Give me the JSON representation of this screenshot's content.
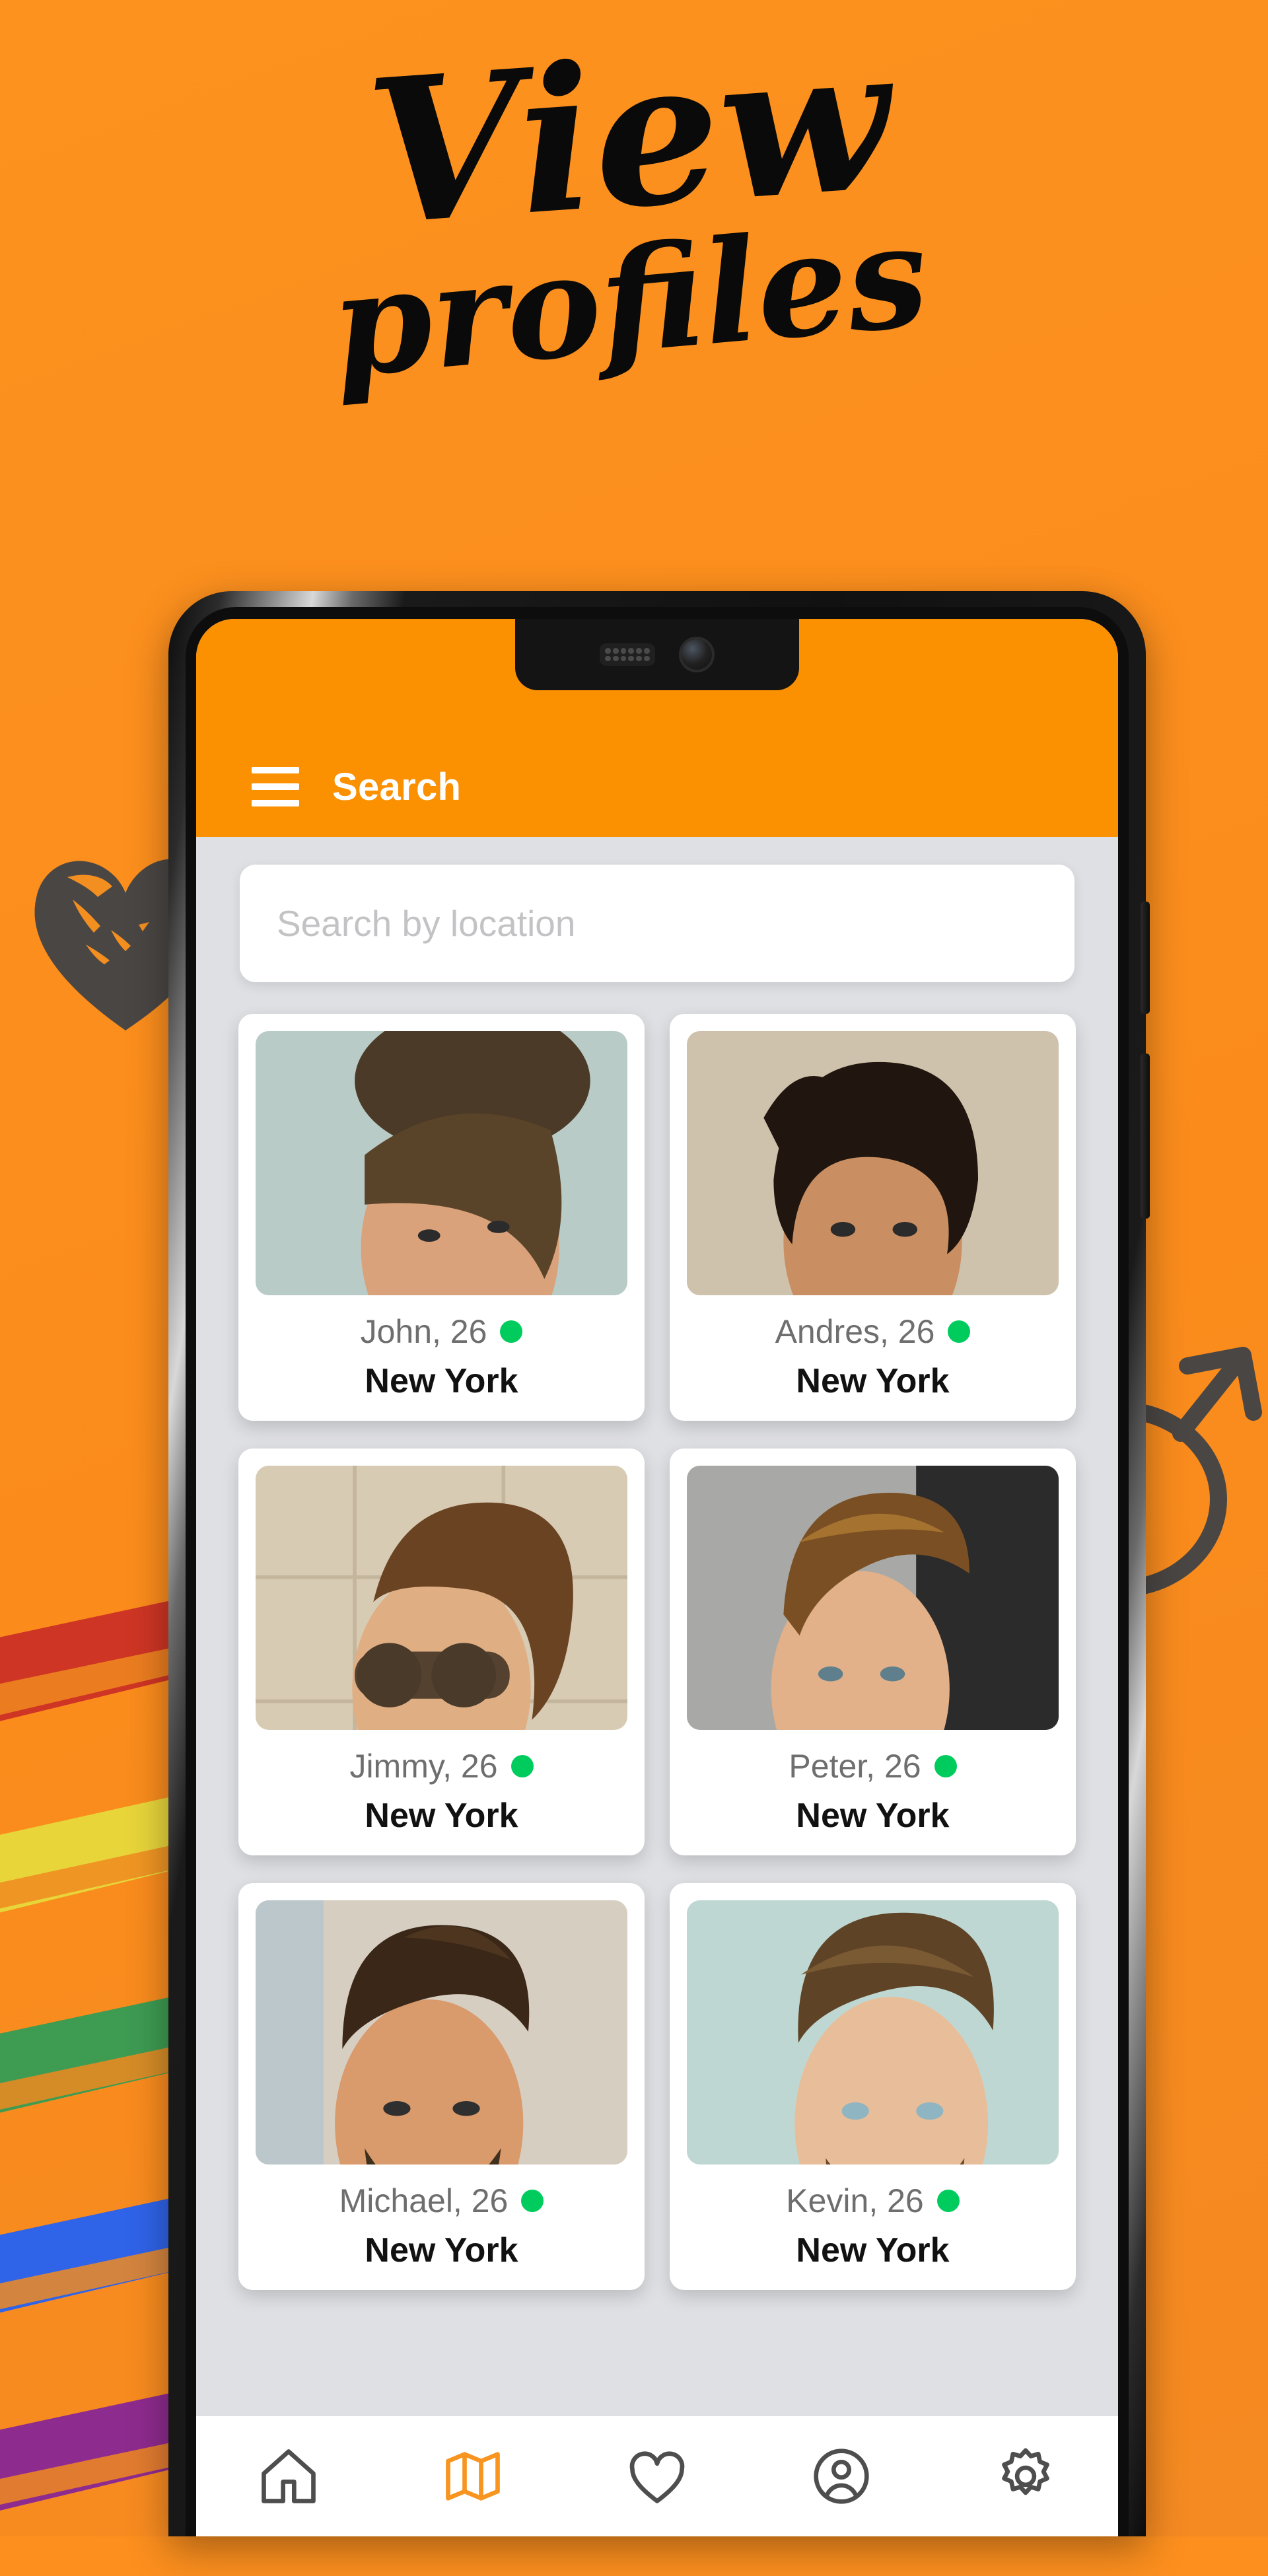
{
  "promo": {
    "title_line1": "View",
    "title_line2": "profiles",
    "background_color": "#FC8F1E",
    "accent_color": "#FB9000",
    "doodles": [
      {
        "name": "heart-doodle",
        "color": "#4A4644"
      },
      {
        "name": "male-symbol-doodle",
        "color": "#4A4644"
      }
    ],
    "pride_stripe_colors": [
      "#CE3524",
      "#E8D53A",
      "#3E9B52",
      "#2F63E8",
      "#8E2B8E"
    ]
  },
  "app": {
    "appbar": {
      "title": "Search",
      "menu_icon": "hamburger-menu-icon",
      "background_color": "#FB9000",
      "title_color": "#FFFFFF"
    },
    "search": {
      "placeholder": "Search by location",
      "value": ""
    },
    "profiles": [
      {
        "name": "John",
        "age": 26,
        "label": "John, 26",
        "city": "New York",
        "online": true,
        "status_color": "#00CC5E"
      },
      {
        "name": "Andres",
        "age": 26,
        "label": "Andres, 26",
        "city": "New York",
        "online": true,
        "status_color": "#00CC5E"
      },
      {
        "name": "Jimmy",
        "age": 26,
        "label": "Jimmy, 26",
        "city": "New York",
        "online": true,
        "status_color": "#00CC5E"
      },
      {
        "name": "Peter",
        "age": 26,
        "label": "Peter, 26",
        "city": "New York",
        "online": true,
        "status_color": "#00CC5E"
      },
      {
        "name": "Michael",
        "age": 26,
        "label": "Michael, 26",
        "city": "New York",
        "online": true,
        "status_color": "#00CC5E"
      },
      {
        "name": "Kevin",
        "age": 26,
        "label": "Kevin, 26",
        "city": "New York",
        "online": true,
        "status_color": "#00CC5E"
      }
    ],
    "bottom_nav": {
      "active_index": 1,
      "active_color": "#F79520",
      "inactive_color": "#4E4E4E",
      "items": [
        {
          "icon": "home-icon",
          "label": "Home",
          "active": false
        },
        {
          "icon": "map-icon",
          "label": "Map",
          "active": true
        },
        {
          "icon": "heart-icon",
          "label": "Likes",
          "active": false
        },
        {
          "icon": "account-icon",
          "label": "Profile",
          "active": false
        },
        {
          "icon": "gear-icon",
          "label": "Settings",
          "active": false
        }
      ]
    }
  }
}
